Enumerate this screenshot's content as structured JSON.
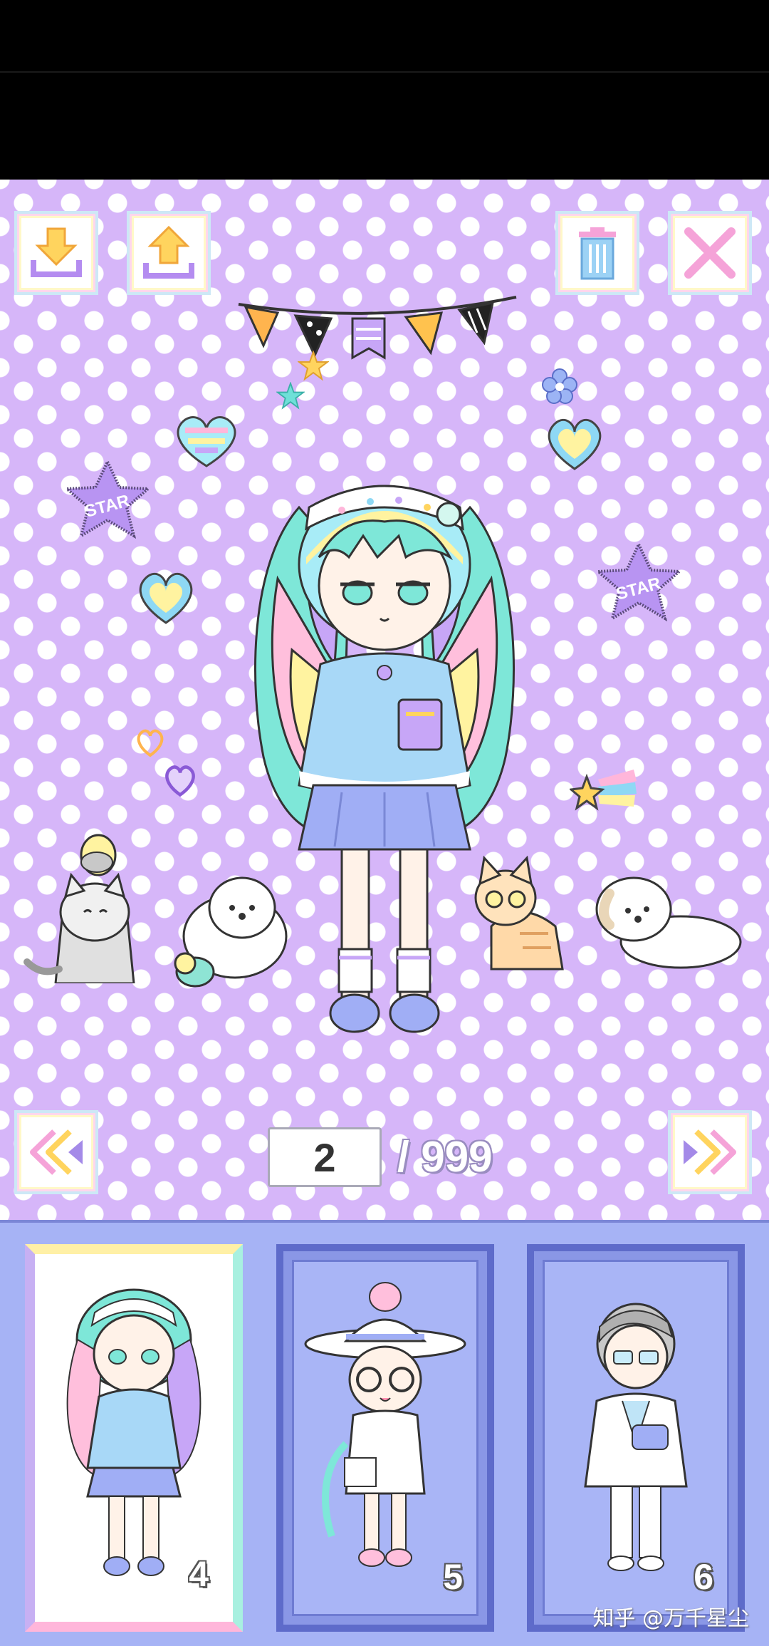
{
  "toolbar": {
    "import_icon": "download-icon",
    "export_icon": "upload-icon",
    "delete_icon": "trash-icon",
    "close_icon": "close-icon"
  },
  "pagination": {
    "current_page": "2",
    "total": "/ 999"
  },
  "slots": [
    {
      "number": "4",
      "selected": true
    },
    {
      "number": "5",
      "selected": false
    },
    {
      "number": "6",
      "selected": false
    }
  ],
  "watermark": "知乎 @万千星尘",
  "deco": {
    "star_badge_text": "STAR"
  },
  "colors": {
    "background": "#d6b6f9",
    "tray": "#a6b3f5",
    "tray_border": "#5e6bca",
    "accent_pink": "#f5a3d8",
    "accent_yellow": "#ffd45e"
  }
}
